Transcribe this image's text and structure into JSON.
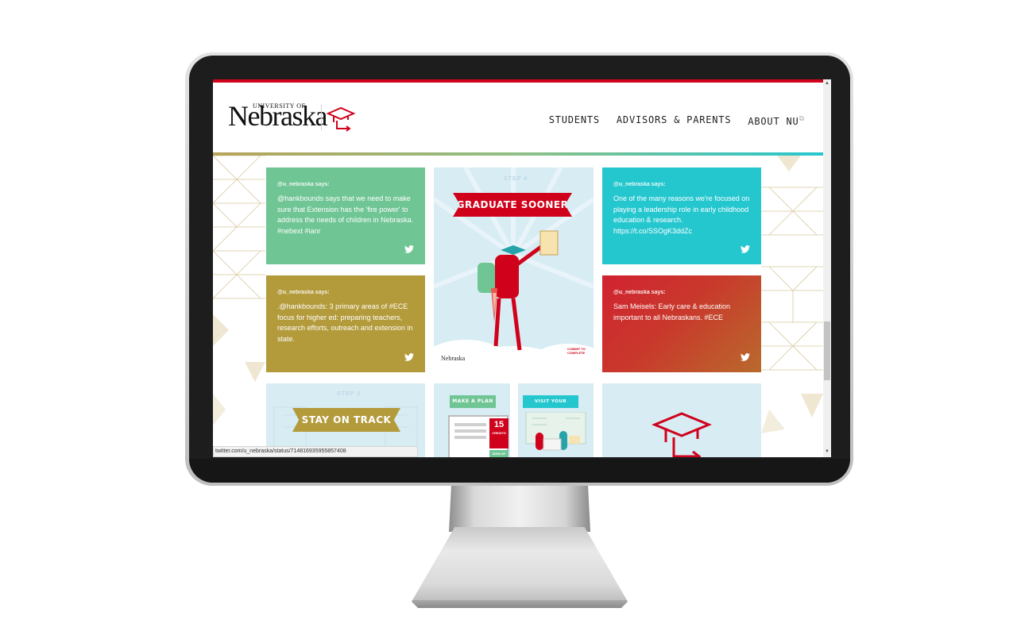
{
  "header": {
    "logo": {
      "top": "UNIVERSITY OF",
      "main": "Nebraska"
    },
    "nav": [
      {
        "label": "STUDENTS"
      },
      {
        "label": "ADVISORS & PARENTS"
      },
      {
        "label": "ABOUT NU"
      }
    ]
  },
  "tweets": [
    {
      "user": "@u_nebraska says:",
      "text": "@hankbounds says that we need to make sure that Extension has the 'fire power' to address the needs of children in Nebraska. #nebext #ianr"
    },
    {
      "user": "@u_nebraska says:",
      "text": "One of the many reasons we're focused on playing a leadership role in early childhood education & research. https://t.co/SSOgK3ddZc"
    },
    {
      "user": "@u_nebraska says:",
      "text": ".@hankbounds: 3 primary areas of #ECE focus for higher ed: preparing teachers, research efforts, outreach and extension in state."
    },
    {
      "user": "@u_nebraska says:",
      "text": "Sam Meisels: Early care & education important to all Nebraskans. #ECE"
    }
  ],
  "step4": {
    "step": "STEP 4",
    "banner": "GRADUATE SOONER",
    "logo": "Nebraska",
    "badge": "COMMIT TO COMPLETE"
  },
  "step3": {
    "step": "STEP 3",
    "banner": "STAY ON TRACK"
  },
  "plan": {
    "banner": "MAKE A PLAN",
    "number": "15",
    "unit": "CREDITS",
    "button": "SIGN UP"
  },
  "advisor": {
    "banner": "VISIT YOUR ADVISOR"
  },
  "status_bar": {
    "url": "twitter.com/u_nebraska/status/714816935955857408"
  },
  "colors": {
    "red": "#d0021b",
    "green": "#6fc594",
    "teal": "#25c7cf",
    "olive": "#b39a3a"
  }
}
